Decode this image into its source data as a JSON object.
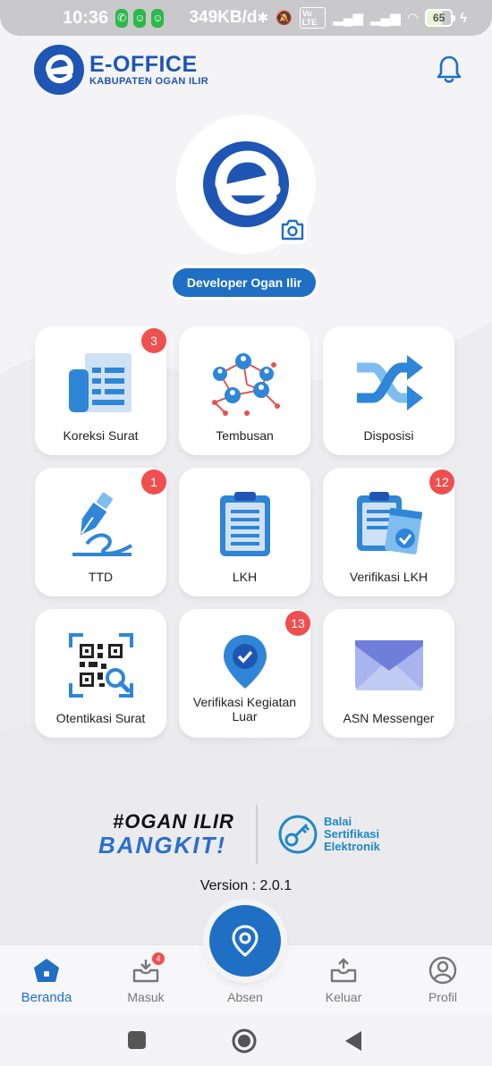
{
  "status_bar": {
    "time": "10:36",
    "speed": "349KB/d",
    "lte": "Vo LTE",
    "battery": "65"
  },
  "header": {
    "brand_title": "E-OFFICE",
    "brand_subtitle": "KABUPATEN OGAN ILIR"
  },
  "profile": {
    "name": "Developer Ogan Ilir"
  },
  "menu": [
    {
      "label": "Koreksi Surat",
      "badge": "3",
      "icon": "document-icon"
    },
    {
      "label": "Tembusan",
      "badge": "",
      "icon": "network-icon"
    },
    {
      "label": "Disposisi",
      "badge": "",
      "icon": "shuffle-icon"
    },
    {
      "label": "TTD",
      "badge": "1",
      "icon": "pen-signature-icon"
    },
    {
      "label": "LKH",
      "badge": "",
      "icon": "clipboard-icon"
    },
    {
      "label": "Verifikasi LKH",
      "badge": "12",
      "icon": "clipboard-check-icon"
    },
    {
      "label": "Otentikasi Surat",
      "badge": "",
      "icon": "qr-code-icon"
    },
    {
      "label": "Verifikasi Kegiatan Luar",
      "badge": "13",
      "icon": "location-check-icon"
    },
    {
      "label": "ASN Messenger",
      "badge": "",
      "icon": "envelope-icon"
    }
  ],
  "footer": {
    "ogan_line1": "#OGAN ILIR",
    "ogan_line2": "BANGKIT!",
    "bsre_line1": "Balai",
    "bsre_line2": "Sertifikasi",
    "bsre_line3": "Elektronik",
    "version": "Version : 2.0.1"
  },
  "bottom_nav": {
    "items": [
      {
        "label": "Beranda",
        "active": true
      },
      {
        "label": "Masuk",
        "badge": "4"
      },
      {
        "label": "Absen"
      },
      {
        "label": "Keluar"
      },
      {
        "label": "Profil"
      }
    ]
  },
  "colors": {
    "primary": "#1f55b3",
    "accent": "#1f6fc4",
    "badge": "#ef4f4f"
  }
}
